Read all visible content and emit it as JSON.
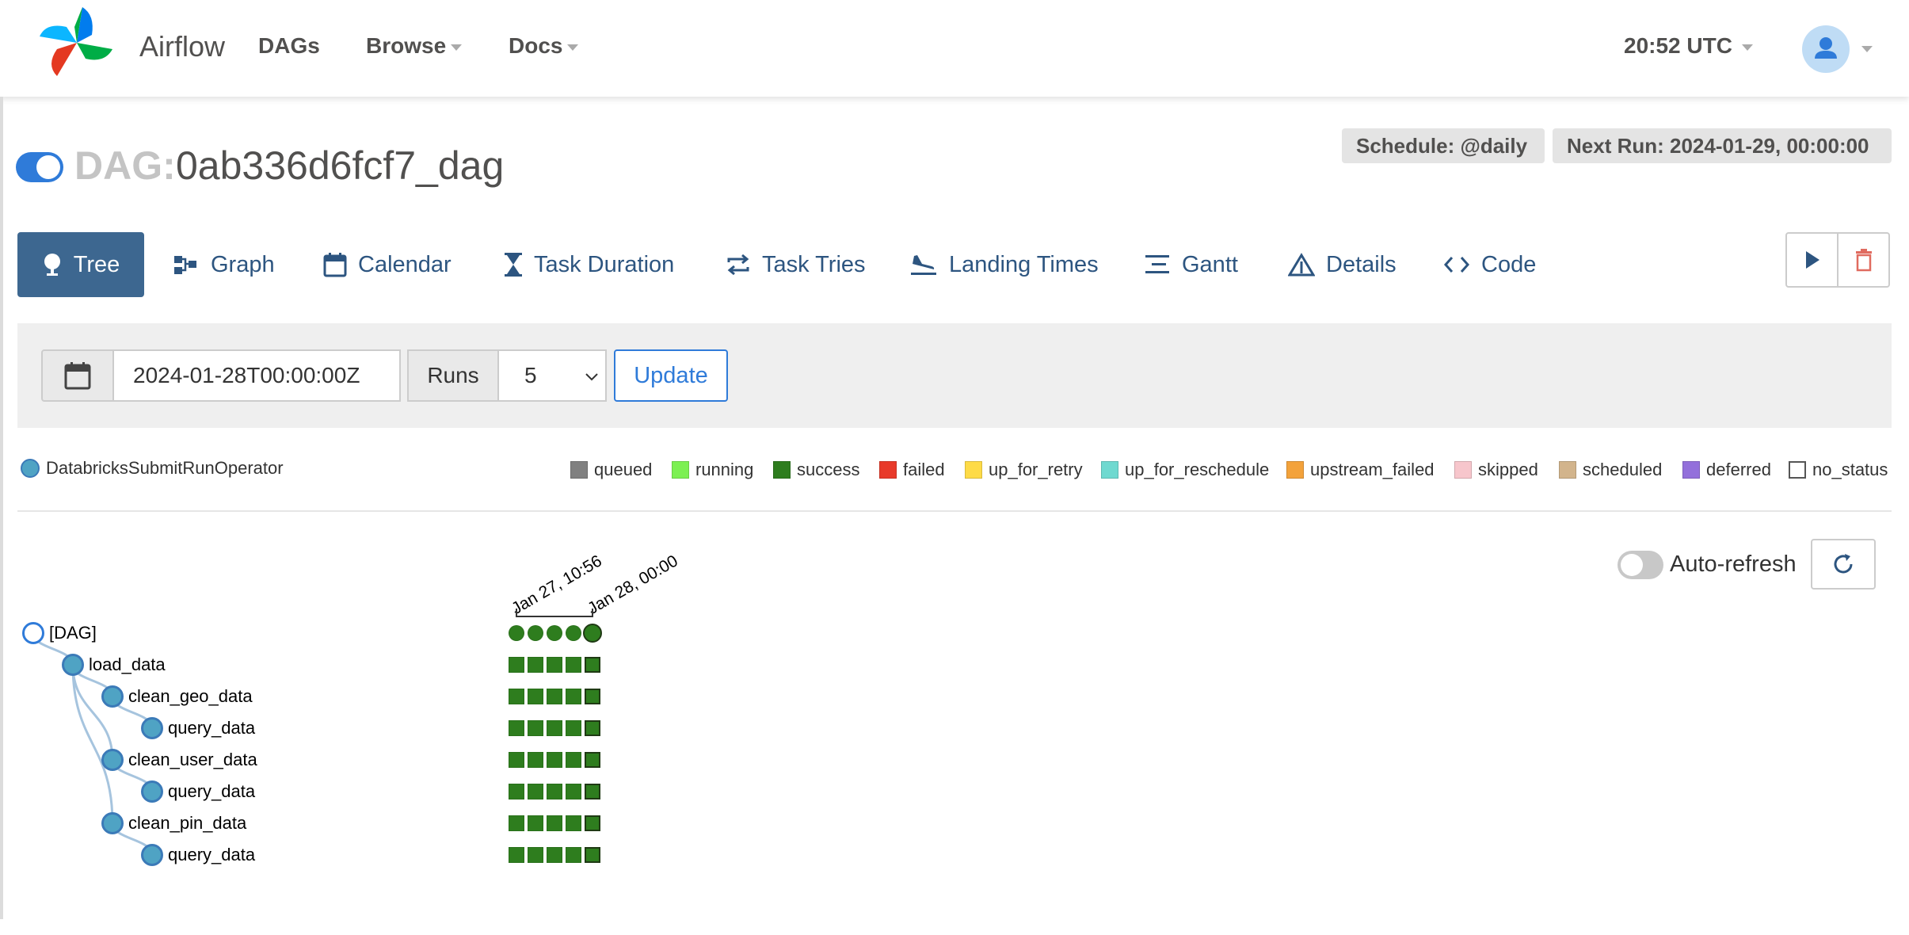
{
  "navbar": {
    "brand": "Airflow",
    "links": [
      "DAGs",
      "Browse",
      "Docs"
    ],
    "time": "20:52 UTC"
  },
  "dag": {
    "prefix": "DAG:",
    "id": "0ab336d6fcf7_dag",
    "schedule": "Schedule: @daily",
    "next_run": "Next Run: 2024-01-29, 00:00:00"
  },
  "tabs": [
    {
      "label": "Tree",
      "icon": "tree-icon"
    },
    {
      "label": "Graph",
      "icon": "graph-icon"
    },
    {
      "label": "Calendar",
      "icon": "calendar-icon"
    },
    {
      "label": "Task Duration",
      "icon": "hourglass-icon"
    },
    {
      "label": "Task Tries",
      "icon": "retry-icon"
    },
    {
      "label": "Landing Times",
      "icon": "plane-landing-icon"
    },
    {
      "label": "Gantt",
      "icon": "gantt-icon"
    },
    {
      "label": "Details",
      "icon": "warning-triangle-icon"
    },
    {
      "label": "Code",
      "icon": "code-icon"
    }
  ],
  "form": {
    "base_date": "2024-01-28T00:00:00Z",
    "runs_label": "Runs",
    "runs_value": "5",
    "update_label": "Update"
  },
  "legend": {
    "operator": "DatabricksSubmitRunOperator",
    "states": [
      {
        "name": "queued",
        "color": "#808080"
      },
      {
        "name": "running",
        "color": "#7cf052"
      },
      {
        "name": "success",
        "color": "#2e7d1e"
      },
      {
        "name": "failed",
        "color": "#e83a2a"
      },
      {
        "name": "up_for_retry",
        "color": "#fedb47"
      },
      {
        "name": "up_for_reschedule",
        "color": "#6fd9d0"
      },
      {
        "name": "upstream_failed",
        "color": "#f3a23b"
      },
      {
        "name": "skipped",
        "color": "#f7c6cc"
      },
      {
        "name": "scheduled",
        "color": "#d2b48c"
      },
      {
        "name": "deferred",
        "color": "#9370db"
      },
      {
        "name": "no_status",
        "color": "#ffffff"
      }
    ]
  },
  "auto_refresh_label": "Auto-refresh",
  "tree": {
    "run_labels": [
      "Jan 27, 10:56",
      "Jan 28, 00:00"
    ],
    "nodes": [
      {
        "label": "[DAG]",
        "depth": 0,
        "kind": "dag"
      },
      {
        "label": "load_data",
        "depth": 1,
        "kind": "task"
      },
      {
        "label": "clean_geo_data",
        "depth": 2,
        "kind": "task"
      },
      {
        "label": "query_data",
        "depth": 3,
        "kind": "task"
      },
      {
        "label": "clean_user_data",
        "depth": 2,
        "kind": "task"
      },
      {
        "label": "query_data",
        "depth": 3,
        "kind": "task"
      },
      {
        "label": "clean_pin_data",
        "depth": 2,
        "kind": "task"
      },
      {
        "label": "query_data",
        "depth": 3,
        "kind": "task"
      }
    ],
    "runs_per_task": 5,
    "instance_state": "success"
  }
}
